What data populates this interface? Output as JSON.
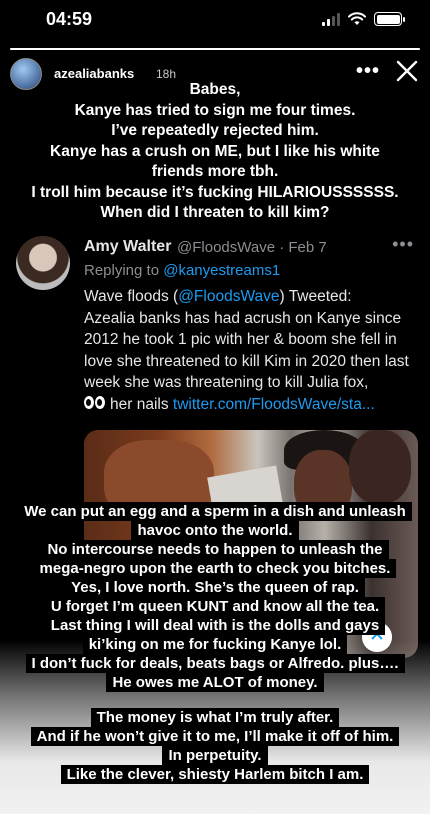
{
  "status_bar": {
    "time": "04:59",
    "battery_level": 1.0
  },
  "story": {
    "progress": 1.0,
    "username": "azealiabanks",
    "time_ago": "18h",
    "more_label": "•••"
  },
  "top_caption": [
    "Babes,",
    "Kanye has tried to sign me four times.",
    "I’ve repeatedly rejected him.",
    "Kanye has a crush on ME, but I like his white",
    "friends more tbh.",
    "I troll him because it’s fucking HILARIOUSSSSSS.",
    "When did I threaten to kill kim?"
  ],
  "tweet": {
    "name": "Amy Walter",
    "handle": "@FloodsWave · Feb 7",
    "more": "•••",
    "replying_prefix": "Replying to ",
    "replying_to": "@kanyestreams1",
    "body_line1_pre": "Wave floods (",
    "body_line1_link": "@FloodsWave",
    "body_line1_post": ") Tweeted:",
    "body_main": "Azealia banks has had acrush on Kanye since 2012 he took 1 pic with her & boom she fell in love she threatened to kill Kim in 2020 then last week she was threatening to kill Julia fox,",
    "body_tail": "her nails",
    "link_url": "twitter.com/FloodsWave/sta..."
  },
  "mid_caption": [
    "We can put an egg and a sperm in a dish and unleash",
    "havoc onto the world.",
    "No intercourse needs to happen to unleash the",
    "mega-negro upon the earth to check you bitches.",
    "Yes, I love north. She’s  the queen of rap.",
    "U forget I’m queen KUNT and know all the tea.",
    "Last thing I will deal with is the dolls and gays",
    "ki’king on me for fucking Kanye lol.",
    "I don’t fuck for deals, beats bags or Alfredo. plus….",
    "He owes me ALOT of money."
  ],
  "bottom_caption": [
    "The money is what I’m truly after.",
    "And if he won’t give it to me, I’ll make it off of him.",
    "In perpetuity.",
    "Like the clever, shiesty Harlem bitch I am."
  ]
}
